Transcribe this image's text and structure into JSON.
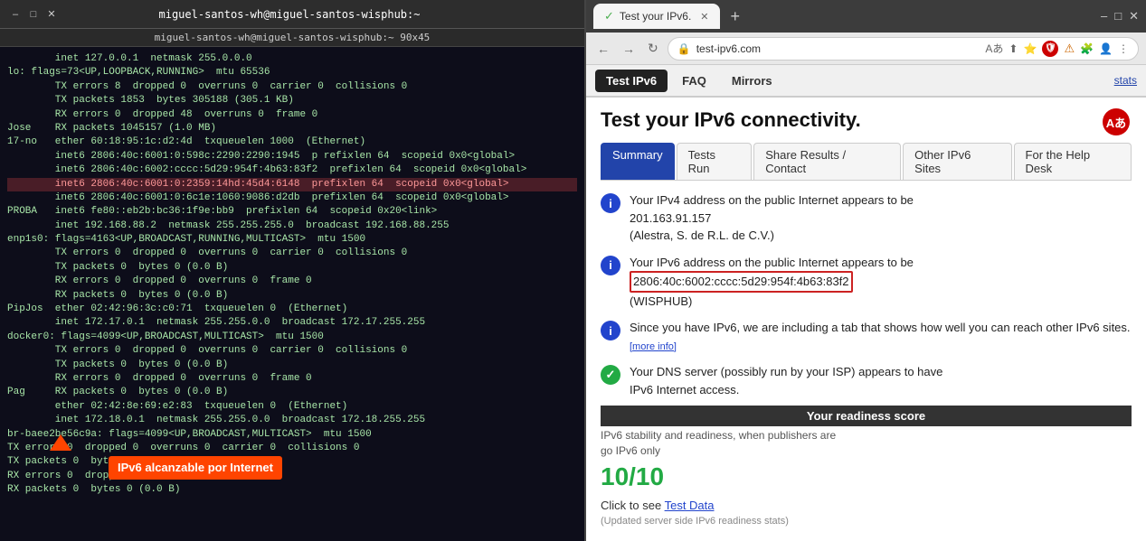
{
  "terminal": {
    "title": "miguel-santos-wh@miguel-santos-wisphub:~",
    "subtitle": "miguel-santos-wh@miguel-santos-wisphub:~ 90x45",
    "controls": [
      "–",
      "□",
      "✕"
    ],
    "lines": [
      "RX packets 0  bytes 0 (0.0 B)",
      "RX errors 0  dropped 0  overruns 0  frame 0",
      "TX packets 0  bytes 0 (0.0 B)",
      "TX errors 0  dropped 0  overruns 0  carrier 0  collisions 0",
      "",
      "br-baee2be56c9a: flags=4099<UP,BROADCAST,MULTICAST>  mtu 1500",
      "        inet 172.18.0.1  netmask 255.255.0.0  broadcast 172.18.255.255",
      "        ether 02:42:8e:69:e2:83  txqueuelen 0  (Ethernet)",
      "Pag     RX packets 0  bytes 0 (0.0 B)",
      "        RX errors 0  dropped 0  overruns 0  frame 0",
      "        TX packets 0  bytes 0 (0.0 B)",
      "        TX errors 0  dropped 0  overruns 0  carrier 0  collisions 0",
      "",
      "docker0: flags=4099<UP,BROADCAST,MULTICAST>  mtu 1500",
      "        inet 172.17.0.1  netmask 255.255.0.0  broadcast 172.17.255.255",
      "PipJos  ether 02:42:96:3c:c0:71  txqueuelen 0  (Ethernet)",
      "        RX packets 0  bytes 0 (0.0 B)",
      "        RX errors 0  dropped 0  overruns 0  frame 0",
      "        TX packets 0  bytes 0 (0.0 B)",
      "        TX errors 0  dropped 0  overruns 0  carrier 0  collisions 0",
      "",
      "enp1s0: flags=4163<UP,BROADCAST,RUNNING,MULTICAST>  mtu 1500",
      "        inet 192.168.88.2  netmask 255.255.255.0  broadcast 192.168.88.255",
      "PROBA   inet6 fe80::eb2b:bc36:1f9e:bb9  prefixlen 64  scopeid 0x20<link>",
      "        inet6 2806:40c:6001:0:6c1e:1060:9086:d2db  prefixlen 64  scopeid 0x0<global>",
      "        inet6 2806:40c:6001:0:2359:14hd:45d4:6148  prefixlen 64  scopeid 0x0<global>",
      "        inet6 2806:40c:6002:cccc:5d29:954f:4b63:83f2  prefixlen 64  scopeid 0x0<global>",
      "        inet6 2806:40c:6001:0:598c:2290:2290:1945  p refixlen 64  scopeid 0x0<global>",
      "17-no   ether 60:18:95:1c:d2:4d  txqueuelen 1000  (Ethernet)",
      "Jose    RX packets 1045157 (1.0 MB)",
      "        RX errors 0  dropped 48  overruns 0  frame 0",
      "        TX packets 1853  bytes 305188 (305.1 KB)",
      "        TX errors 8  dropped 0  overruns 0  carrier 0  collisions 0",
      "",
      "lo: flags=73<UP,LOOPBACK,RUNNING>  mtu 65536",
      "        inet 127.0.0.1  netmask 255.0.0.0"
    ],
    "highlight_line_index": 25,
    "arrow_label": "IPv6 alcanzable por Internet"
  },
  "browser": {
    "tab_title": "Test your IPv6.",
    "tab_favicon": "✓",
    "address": "test-ipv6.com",
    "site_tabs": [
      {
        "label": "Test IPv6",
        "active": true
      },
      {
        "label": "FAQ",
        "active": false
      },
      {
        "label": "Mirrors",
        "active": false
      }
    ],
    "stats_label": "stats",
    "page_title": "Test your IPv6 connectivity.",
    "content_tabs": [
      {
        "label": "Summary",
        "active": true
      },
      {
        "label": "Tests Run",
        "active": false
      },
      {
        "label": "Share Results / Contact",
        "active": false
      },
      {
        "label": "Other IPv6 Sites",
        "active": false
      },
      {
        "label": "For the Help Desk",
        "active": false
      }
    ],
    "info_items": [
      {
        "icon_type": "blue",
        "icon_text": "i",
        "text": "Your IPv4 address on the public Internet appears to be\n201.163.91.157\n(Alestra, S. de R.L. de C.V.)"
      },
      {
        "icon_type": "blue",
        "icon_text": "i",
        "text": "Your IPv6 address on the public Internet appears to be",
        "highlighted_text": "2806:40c:6002:cccc:5d29:954f:4b63:83f2",
        "sub_text": "(WISPHUB)"
      },
      {
        "icon_type": "blue",
        "icon_text": "i",
        "text": "Since you have IPv6, we are including a tab that shows how well you can reach other IPv6 sites.",
        "more_info": true
      },
      {
        "icon_type": "green",
        "icon_text": "✓",
        "text": "Your DNS server (possibly run by your ISP) appears to have IPv6 Internet access."
      }
    ],
    "readiness_bar_label": "Your readiness score",
    "readiness_sub": "IPv6 stability and readiness, when publishers are\ngo IPv6 only",
    "score": "10/10",
    "click_label": "Click to see",
    "test_data_link": "Test Data",
    "updated_text": "(Updated server side IPv6 readiness stats)"
  }
}
